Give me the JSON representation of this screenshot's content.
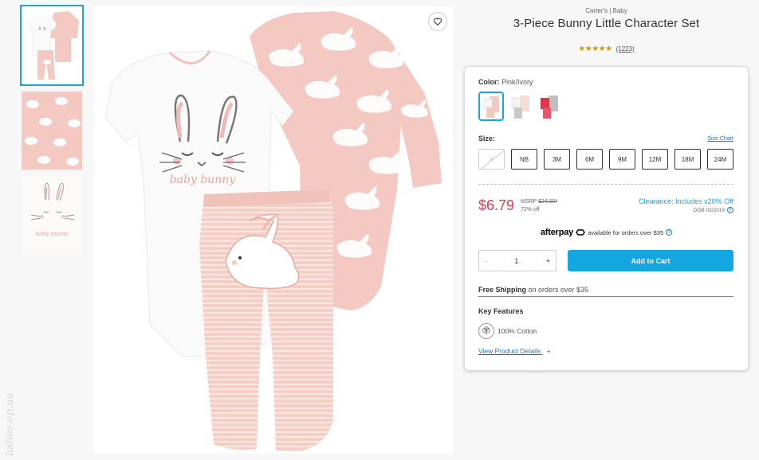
{
  "product": {
    "brand": "Carter's | Baby",
    "title": "3-Piece Bunny Little Character Set",
    "stars": "★★★★★",
    "review_count": "(1223)",
    "rating_value": 5
  },
  "options": {
    "color_label": "Color:",
    "color_value": "Pink/Ivory",
    "size_label": "Size:",
    "size_chart": "Size Chart",
    "sizes": [
      "P",
      "NB",
      "3M",
      "6M",
      "9M",
      "12M",
      "18M",
      "24M"
    ]
  },
  "pricing": {
    "price": "$6.79",
    "msrp_label": "MSRP",
    "msrp_value": "$24.00*",
    "discount": "72% off",
    "clearance": "Clearance: Includes x20% Off",
    "dob": "DOB 03/2019",
    "info_icon": "i"
  },
  "afterpay": {
    "logo": "afterpay",
    "text": "available for orders over $35",
    "info_icon": "i"
  },
  "cart": {
    "minus": "-",
    "quantity": "1",
    "plus": "+",
    "add_to_cart": "Add to Cart"
  },
  "shipping": {
    "bold": "Free Shipping",
    "rest": "on orders over $35"
  },
  "features": {
    "title": "Key Features",
    "item": "100% Cotton",
    "item_icon": "cotton-icon",
    "details_link": "View Product Details",
    "details_plus": "+"
  },
  "watermark": "ladies.ep.ua",
  "colors": {
    "accent": "#13a6e2",
    "price": "#e23a4e",
    "star": "#c89a18",
    "link": "#1b75bc",
    "pink": "#f4c9c1"
  }
}
